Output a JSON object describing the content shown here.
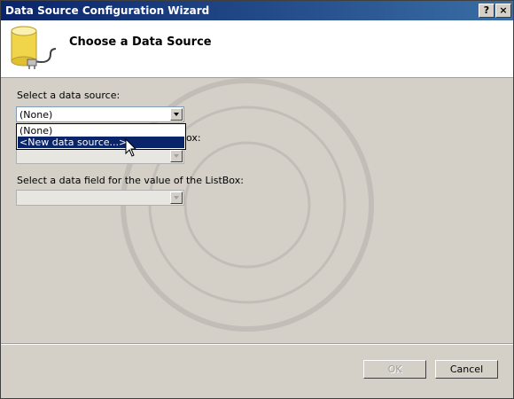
{
  "window": {
    "title": "Data Source Configuration Wizard",
    "help_label": "?",
    "close_label": "×"
  },
  "header": {
    "title": "Choose a Data Source"
  },
  "form": {
    "data_source_label": "Select a data source:",
    "data_source_value": "(None)",
    "dropdown_options": [
      "(None)",
      "<New data source...>"
    ],
    "display_field_label_suffix": "ox:",
    "value_field_label": "Select a data field for the value of the ListBox:"
  },
  "footer": {
    "ok_label": "OK",
    "cancel_label": "Cancel"
  },
  "colors": {
    "title_bar": "#0a246a",
    "selection": "#0a246a",
    "background": "#d4d0c8"
  }
}
